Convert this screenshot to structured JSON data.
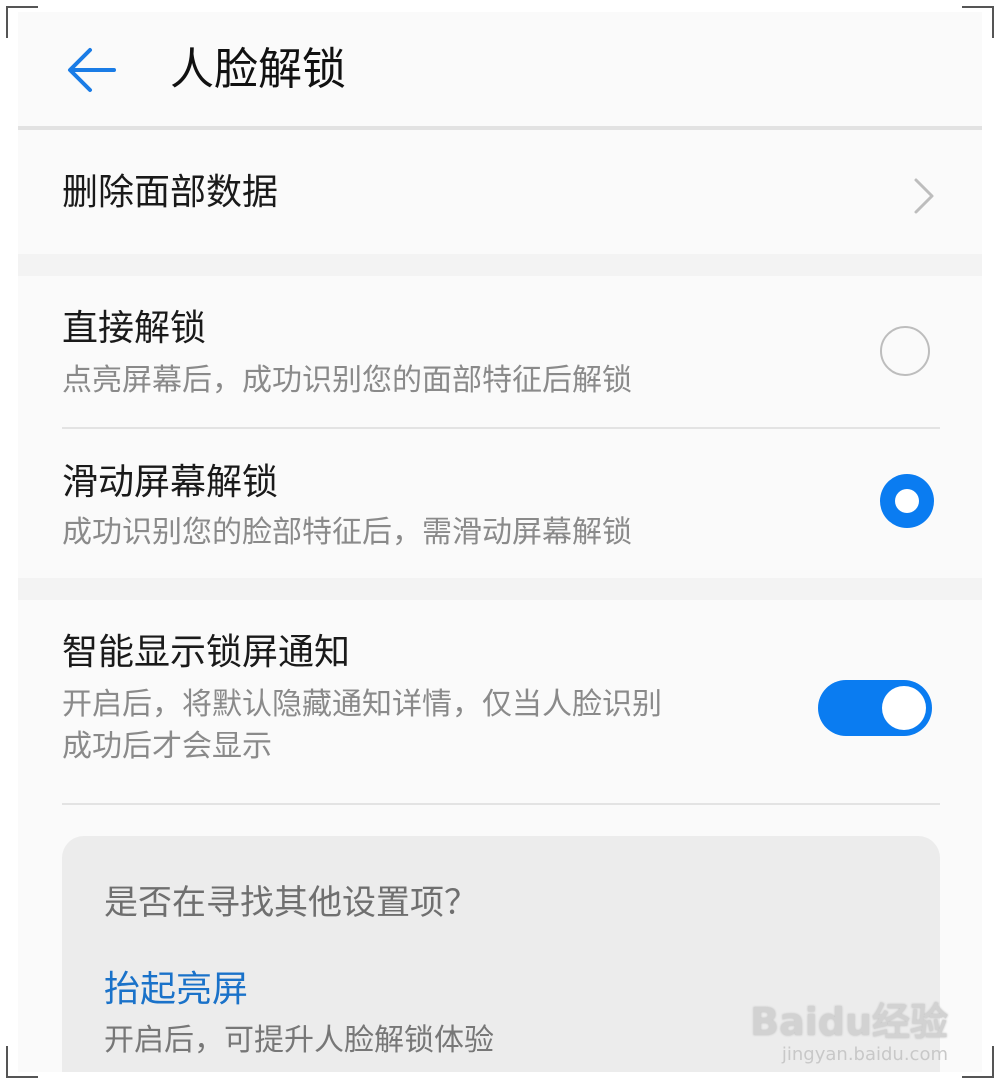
{
  "header": {
    "title": "人脸解锁",
    "back_icon": "arrow-left-icon"
  },
  "colors": {
    "accent": "#0a7cf1",
    "link": "#1a72c9",
    "background": "#f3f3f3",
    "card": "#fafafa"
  },
  "delete_face": {
    "label": "删除面部数据",
    "icon": "chevron-right-icon"
  },
  "unlock_modes": {
    "direct": {
      "title": "直接解锁",
      "subtitle": "点亮屏幕后，成功识别您的面部特征后解锁",
      "selected": false
    },
    "swipe": {
      "title": "滑动屏幕解锁",
      "subtitle": "成功识别您的脸部特征后，需滑动屏幕解锁",
      "selected": true
    }
  },
  "smart_notify": {
    "title": "智能显示锁屏通知",
    "subtitle_line1": "开启后，将默认隐藏通知详情，仅当人脸识别",
    "subtitle_line2": "成功后才会显示",
    "enabled": true
  },
  "suggestion": {
    "question": "是否在寻找其他设置项？",
    "link_label": "抬起亮屏",
    "link_subtitle": "开启后，可提升人脸解锁体验"
  },
  "watermark": {
    "logo": "Baidu经验",
    "url": "jingyan.baidu.com"
  }
}
